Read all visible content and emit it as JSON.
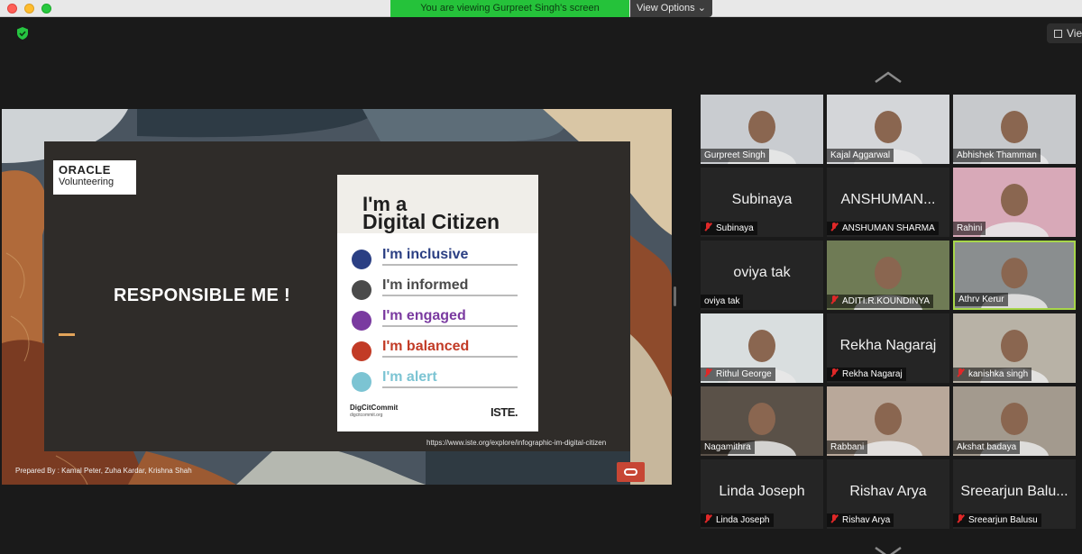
{
  "window": {
    "share_banner": "You are viewing Gurpreet Singh's screen",
    "view_options": "View Options",
    "view_button": "Vie"
  },
  "slide": {
    "logo_line1": "ORACLE",
    "logo_line2": "Volunteering",
    "title": "RESPONSIBLE ME !",
    "url": "https://www.iste.org/explore/infographic-im-digital-citizen",
    "prepared_by": "Prepared By : Kamal Peter, Zuha Kardar, Krishna Shah",
    "poster": {
      "title_line1": "I'm a",
      "title_line2": "Digital Citizen",
      "items": [
        {
          "label": "I'm inclusive",
          "color": "#2b3f83",
          "icon": "handshake-icon"
        },
        {
          "label": "I'm informed",
          "color": "#4a4a4a",
          "icon": "lightbulb-icon"
        },
        {
          "label": "I'm engaged",
          "color": "#7a3aa0",
          "icon": "megaphone-icon"
        },
        {
          "label": "I'm balanced",
          "color": "#c23b26",
          "icon": "scale-icon"
        },
        {
          "label": "I'm alert",
          "color": "#7cc4d3",
          "icon": "fingerprint-icon"
        }
      ],
      "footer_left": "DigCitCommit",
      "footer_small": "digcitcommit.org",
      "footer_right": "ISTE."
    }
  },
  "participants": [
    {
      "name": "Gurpreet Singh",
      "video": true,
      "muted": false,
      "bg": "#c9ccd0"
    },
    {
      "name": "Kajal Aggarwal",
      "video": true,
      "muted": false,
      "bg": "#d4d6d9"
    },
    {
      "name": "Abhishek Thamman",
      "video": true,
      "muted": false,
      "bg": "#c7c9cc"
    },
    {
      "name": "Subinaya",
      "display": "Subinaya",
      "video": false,
      "muted": true
    },
    {
      "name": "ANSHUMAN SHARMA",
      "display": "ANSHUMAN...",
      "video": false,
      "muted": true
    },
    {
      "name": "Rahini",
      "video": true,
      "muted": false,
      "bg": "#d8a9b8"
    },
    {
      "name": "oviya tak",
      "display": "oviya tak",
      "video": false,
      "muted": false
    },
    {
      "name": "ADITI.R.KOUNDINYA",
      "video": true,
      "muted": true,
      "bg": "#6f7b55"
    },
    {
      "name": "Athrv Kerur",
      "video": true,
      "muted": false,
      "bg": "#8a8e8f",
      "active": true
    },
    {
      "name": "Rithul George",
      "video": true,
      "muted": true,
      "bg": "#d9dedf"
    },
    {
      "name": "Rekha Nagaraj",
      "display": "Rekha Nagaraj",
      "video": false,
      "muted": true
    },
    {
      "name": "kanishka singh",
      "video": true,
      "muted": true,
      "bg": "#b8b2a6"
    },
    {
      "name": "Nagamithra",
      "video": true,
      "muted": false,
      "bg": "#5a5148"
    },
    {
      "name": "Rabbani",
      "video": true,
      "muted": false,
      "bg": "#b9a89a"
    },
    {
      "name": "Akshat badaya",
      "video": true,
      "muted": false,
      "bg": "#a39a8e"
    },
    {
      "name": "Linda Joseph",
      "display": "Linda Joseph",
      "video": false,
      "muted": true
    },
    {
      "name": "Rishav Arya",
      "display": "Rishav Arya",
      "video": false,
      "muted": true
    },
    {
      "name": "Sreearjun Balusu",
      "display": "Sreearjun Balu...",
      "video": false,
      "muted": true
    }
  ]
}
